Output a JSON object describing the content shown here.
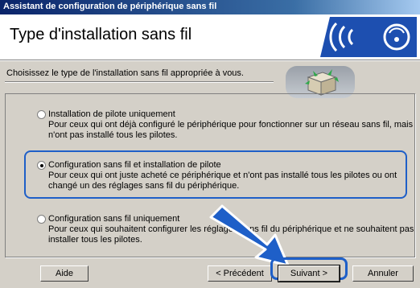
{
  "window": {
    "title": "Assistant de configuration de périphérique sans fil"
  },
  "header": {
    "page_title": "Type d'installation sans fil"
  },
  "intro": {
    "text": "Choisissez le type de l'installation sans fil appropriée à vous."
  },
  "options": [
    {
      "label": "Installation de pilote uniquement",
      "description": "Pour ceux qui ont déjà configuré le périphérique pour fonctionner sur un réseau sans fil, mais n'ont pas installé tous les pilotes.",
      "selected": false
    },
    {
      "label": "Configuration sans fil et installation de pilote",
      "description": "Pour ceux qui ont juste acheté ce périphérique et n'ont pas installé tous les pilotes ou ont changé un des réglages sans fil du périphérique.",
      "selected": true
    },
    {
      "label": "Configuration sans fil uniquement",
      "description": "Pour ceux qui souhaitent configurer les réglages sans fil du périphérique et ne souhaitent pas installer tous les pilotes.",
      "selected": false
    }
  ],
  "buttons": {
    "help": "Aide",
    "back": "< Précédent",
    "next": "Suivant >",
    "cancel": "Annuler"
  },
  "colors": {
    "title_bar": "#0a246a",
    "highlight": "#1e5fc8",
    "arrow": "#1e5fc8"
  },
  "icons": [
    "wireless-logo-icon",
    "network-box-icon",
    "pointer-arrow-icon"
  ]
}
